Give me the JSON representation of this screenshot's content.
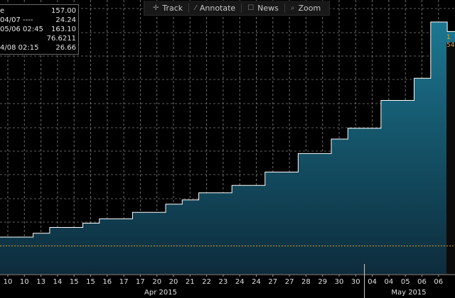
{
  "toolbar": {
    "items": [
      {
        "label": "Track",
        "icon": "crosshair-icon"
      },
      {
        "label": "Annotate",
        "icon": "pencil-icon"
      },
      {
        "label": "News",
        "icon": "newspaper-icon"
      },
      {
        "label": "Zoom",
        "icon": "magnifier-icon"
      }
    ]
  },
  "legend": {
    "rows": [
      {
        "label": "e",
        "value": "157.00"
      },
      {
        "label": "04/07 ----",
        "value": "24.24"
      },
      {
        "label": "05/06 02:45",
        "value": "163.10"
      },
      {
        "label": "",
        "value": "76.6211"
      },
      {
        "label": "4/08 02:15",
        "value": "26.66"
      }
    ]
  },
  "right_marker": {
    "line1": "1",
    "line2": "54"
  },
  "colors": {
    "background": "#000000",
    "area_top": "#1b7791",
    "area_bottom": "#0d2c3c",
    "line": "#ffffff",
    "grid": "#6f6f6f",
    "reference_line": "#e8a020",
    "marker": "#e8a020"
  },
  "chart_data": {
    "type": "area",
    "step": true,
    "x_ticks": [
      "10",
      "10",
      "13",
      "14",
      "15",
      "15",
      "16",
      "17",
      "17",
      "20",
      "20",
      "21",
      "22",
      "23",
      "24",
      "24",
      "27",
      "27",
      "28",
      "29",
      "30",
      "30",
      "04",
      "04",
      "05",
      "06",
      "06"
    ],
    "x_groups": [
      "Apr 2015",
      "May 2015"
    ],
    "y_units": "price level (axis labels not visible)",
    "steps": [
      {
        "x": 0,
        "y": 24.24
      },
      {
        "x": 2,
        "y": 26.7
      },
      {
        "x": 3,
        "y": 30.5
      },
      {
        "x": 5,
        "y": 33.2
      },
      {
        "x": 6,
        "y": 36.0
      },
      {
        "x": 8,
        "y": 40.2
      },
      {
        "x": 10,
        "y": 45.5
      },
      {
        "x": 11,
        "y": 48.2
      },
      {
        "x": 12,
        "y": 52.8
      },
      {
        "x": 14,
        "y": 57.6
      },
      {
        "x": 16,
        "y": 66.2
      },
      {
        "x": 18,
        "y": 78.2
      },
      {
        "x": 20,
        "y": 87.5
      },
      {
        "x": 21,
        "y": 94.5
      },
      {
        "x": 23,
        "y": 112.5
      },
      {
        "x": 25,
        "y": 126.8
      },
      {
        "x": 26,
        "y": 163.1
      },
      {
        "x": 27,
        "y": 157.0
      }
    ],
    "reference_line": {
      "y": 18.5,
      "style": "dotted"
    }
  }
}
